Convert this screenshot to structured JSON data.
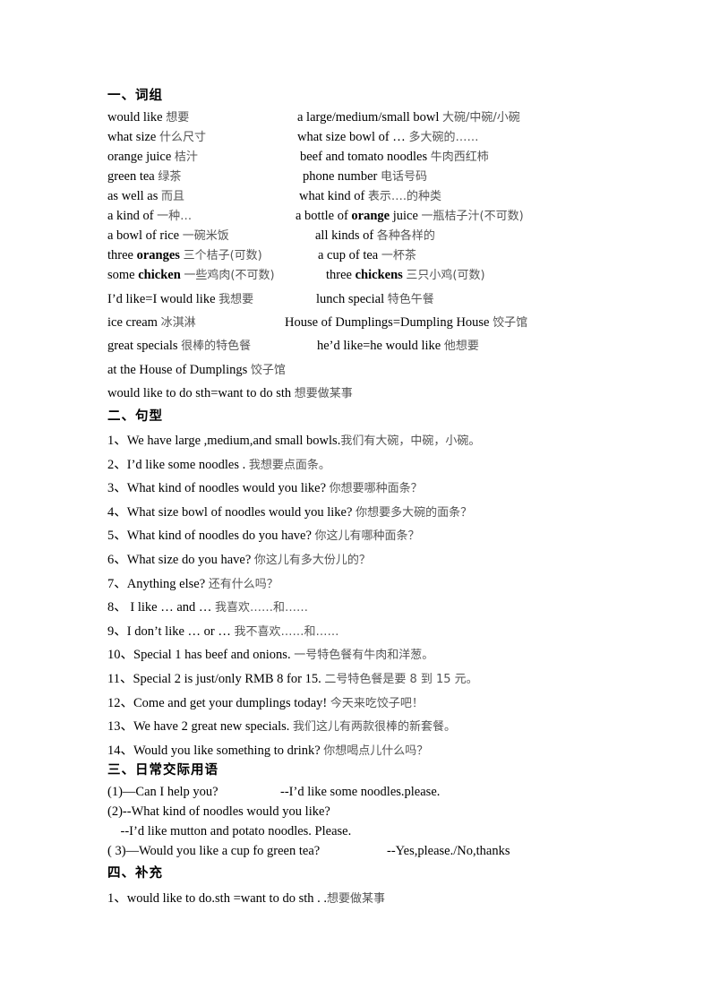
{
  "sections": {
    "s1": {
      "heading": "一、词组",
      "rows": [
        {
          "l_en": "would like ",
          "l_cn": "想要",
          "r_en": "a large/medium/small  bowl ",
          "r_cn": "大碗/中碗/小碗"
        },
        {
          "l_en": "what size ",
          "l_cn": "什么尺寸",
          "r_en": "what size bowl of … ",
          "r_cn": "多大碗的……"
        },
        {
          "l_en": "orange juice ",
          "l_cn": "桔汁",
          "r_en": "beef and tomato noodles ",
          "r_cn": "牛肉西红柿"
        },
        {
          "l_en": "green tea ",
          "l_cn": "绿茶",
          "r_en": "phone number ",
          "r_cn": "电话号码"
        },
        {
          "l_en": "as well as ",
          "l_cn": "而且",
          "r_en": "what kind of ",
          "r_cn": "表示….的种类"
        },
        {
          "l_en": "a kind of ",
          "l_cn": "一种…",
          "r_pre": "a bottle of ",
          "r_bold": "orange",
          "r_en": " juice ",
          "r_cn": "一瓶桔子汁(不可数)"
        },
        {
          "l_en": "a bowl of rice ",
          "l_cn": "一碗米饭",
          "r_en": "all kinds of ",
          "r_cn": "各种各样的"
        },
        {
          "l_pre": "three ",
          "l_bold": "oranges",
          "l_en": " ",
          "l_cn": "三个桔子(可数)",
          "r_en": "a cup of tea ",
          "r_cn": "一杯茶"
        },
        {
          "l_pre": "some ",
          "l_bold": "chicken",
          "l_en": " ",
          "l_cn": "一些鸡肉(不可数)",
          "r_pre": "three ",
          "r_bold": "chickens",
          "r_en": " ",
          "r_cn": "三只小鸡(可数)"
        },
        {
          "l_en": "I’d like=I would like ",
          "l_cn": "我想要",
          "r_en": "lunch special ",
          "r_cn": "特色午餐"
        },
        {
          "l_en": "ice cream ",
          "l_cn": "冰淇淋",
          "r_en": "House of Dumplings=Dumpling House ",
          "r_cn": "饺子馆"
        },
        {
          "l_en": "great specials ",
          "l_cn": "很棒的特色餐",
          "r_en": "he’d like=he would like ",
          "r_cn": "他想要"
        },
        {
          "l_en": "at the House of Dumplings ",
          "l_cn": "饺子馆"
        },
        {
          "l_en": "would like to do sth=want to do sth ",
          "l_cn": "想要做某事"
        }
      ]
    },
    "s2": {
      "heading": "二、句型",
      "items": [
        {
          "en": "1、We have large ,medium,and small  bowls.",
          "cn": "我们有大碗，中碗，小碗。"
        },
        {
          "en": "2、I’d like some noodles . ",
          "cn": "我想要点面条。"
        },
        {
          "en": "3、What kind of noodles would you like? ",
          "cn": "你想要哪种面条？"
        },
        {
          "en": "4、What size bowl of noodles would you like? ",
          "cn": "你想要多大碗的面条？"
        },
        {
          "en": "5、What kind of noodles do you have? ",
          "cn": "你这儿有哪种面条？"
        },
        {
          "en": "6、What size do you have? ",
          "cn": "你这儿有多大份儿的？"
        },
        {
          "en": "7、Anything else? ",
          "cn": "还有什么吗？"
        },
        {
          "en": "8、  I like … and … ",
          "cn": "我喜欢……和……"
        },
        {
          "en": "9、I don’t like … or … ",
          "cn": "我不喜欢……和……"
        },
        {
          "en": "10、Special 1 has beef and onions. ",
          "cn": "一号特色餐有牛肉和洋葱。"
        },
        {
          "en": "11、Special 2 is just/only RMB 8 for 15. ",
          "cn": "二号特色餐是要 8 到 15 元。"
        },
        {
          "en": "12、Come and get your dumplings today! ",
          "cn": "今天来吃饺子吧！"
        },
        {
          "en": "13、We have 2 great new specials. ",
          "cn": "我们这儿有两款很棒的新套餐。"
        },
        {
          "en": "14、Would you like something to drink? ",
          "cn": "你想喝点儿什么吗？"
        }
      ]
    },
    "s3": {
      "heading": "三、日常交际用语",
      "lines": [
        {
          "a": "(1)—Can I help you?",
          "b": "--I’d like some noodles.please."
        },
        {
          "a": "(2)--What kind of noodles would you like?"
        },
        {
          "a": "    --I’d like mutton and potato noodles. Please."
        },
        {
          "a": "( 3)—Would you like a cup fo green tea?",
          "b": "--Yes,please./No,thanks"
        }
      ]
    },
    "s4": {
      "heading": "四、补充",
      "items": [
        {
          "en": "1、would like to do.sth =want to do sth . .",
          "cn": "想要做某事"
        }
      ]
    }
  }
}
